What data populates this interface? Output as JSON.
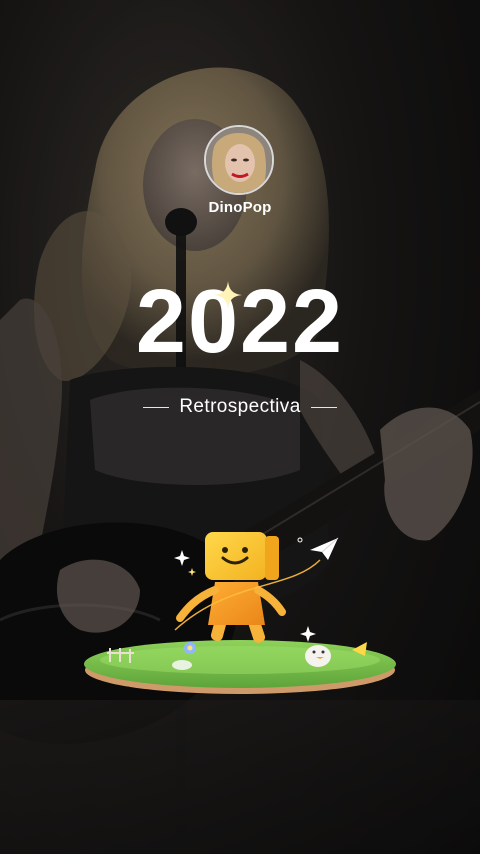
{
  "profile": {
    "username": "DinoPop"
  },
  "hero": {
    "year": "2022",
    "subtitle": "Retrospectiva"
  },
  "colors": {
    "text": "#ffffff",
    "avatar_border": "#d9d9d9",
    "mascot_head": "#f7c531",
    "mascot_body": "#f49a22",
    "grass": "#7cc24a"
  },
  "icons": {
    "sparkle": "four-point-star",
    "paper_plane": "paper-plane",
    "mascot": "box-head-character"
  }
}
